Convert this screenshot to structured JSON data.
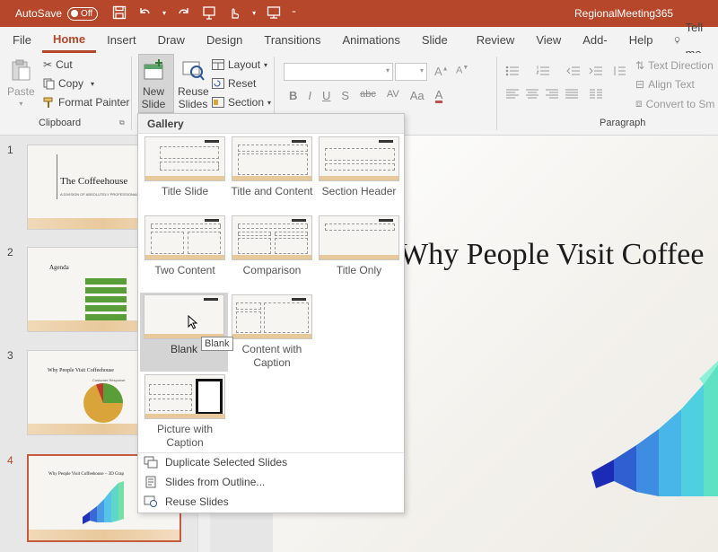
{
  "titlebar": {
    "autosave_label": "AutoSave",
    "autosave_state": "Off",
    "document_title": "RegionalMeeting365"
  },
  "tabs": [
    "File",
    "Home",
    "Insert",
    "Draw",
    "Design",
    "Transitions",
    "Animations",
    "Slide Show",
    "Review",
    "View",
    "Add-ins",
    "Help"
  ],
  "tellme": "Tell me",
  "ribbon": {
    "clipboard": {
      "paste": "Paste",
      "cut": "Cut",
      "copy": "Copy",
      "format_painter": "Format Painter",
      "label": "Clipboard"
    },
    "slides": {
      "new_slide": "New Slide",
      "reuse_slides": "Reuse Slides",
      "layout": "Layout",
      "reset": "Reset",
      "section": "Section"
    },
    "paragraph": {
      "text_direction": "Text Direction",
      "align_text": "Align Text",
      "convert_to_smartart": "Convert to Sm",
      "label": "Paragraph"
    },
    "format_buttons": [
      "B",
      "I",
      "U",
      "S",
      "abc",
      "AV",
      "Aa",
      "A"
    ]
  },
  "slides": [
    {
      "num": "1",
      "title": "The Coffeehouse",
      "subtitle": "A DIVISION OF ABSOLUTELY PROFESSIONAL GROUP"
    },
    {
      "num": "2",
      "title": "Agenda"
    },
    {
      "num": "3",
      "title": "Why People Visit Coffeehouse",
      "chart_title": "Customer Response",
      "chart_labels": [
        "Reviews",
        "Atmosphere",
        "Price"
      ]
    },
    {
      "num": "4",
      "title": "Why People Visit Coffeehouse – 3D Grap"
    }
  ],
  "main_slide": {
    "title": "Why People Visit Coffee"
  },
  "gallery": {
    "header": "Gallery",
    "layouts": [
      "Title Slide",
      "Title and Content",
      "Section Header",
      "Two Content",
      "Comparison",
      "Title Only",
      "Blank",
      "Content with Caption",
      "Picture with Caption"
    ],
    "tooltip": "Blank",
    "commands": [
      "Duplicate Selected Slides",
      "Slides from Outline...",
      "Reuse Slides"
    ]
  },
  "colors": {
    "accent": "#b7472a",
    "agenda_green": "#5a9e3a",
    "pie_orange": "#d9a53a",
    "pie_green": "#5a9e3a",
    "pie_red": "#c0392b"
  }
}
